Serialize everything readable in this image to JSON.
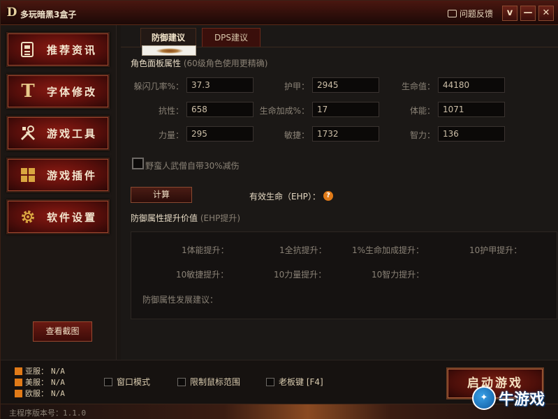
{
  "app": {
    "title": "多玩暗黑3盒子",
    "logo_letter": "D"
  },
  "titlebar": {
    "feedback_label": "问题反馈",
    "buttons": [
      "v",
      "—",
      "✕"
    ]
  },
  "sidebar": {
    "items": [
      {
        "label": "推荐资讯",
        "icon": "news-icon"
      },
      {
        "label": "字体修改",
        "icon": "font-icon"
      },
      {
        "label": "游戏工具",
        "icon": "tools-icon"
      },
      {
        "label": "游戏插件",
        "icon": "plugins-icon"
      },
      {
        "label": "软件设置",
        "icon": "gear-icon"
      }
    ],
    "screenshot_button": "查看截图"
  },
  "tabs": {
    "active": "防御建议",
    "other": "DPS建议"
  },
  "panel": {
    "title": "角色面板属性",
    "subtitle": "(60级角色使用更精确)",
    "fields": [
      {
        "label": "躲闪几率%：",
        "value": "37.3"
      },
      {
        "label": "护甲：",
        "value": "2945"
      },
      {
        "label": "生命值：",
        "value": "44180"
      },
      {
        "label": "抗性：",
        "value": "658"
      },
      {
        "label": "生命加成%：",
        "value": "17"
      },
      {
        "label": "体能：",
        "value": "1071"
      },
      {
        "label": "力量：",
        "value": "295"
      },
      {
        "label": "敏捷：",
        "value": "1732"
      },
      {
        "label": "智力：",
        "value": "136"
      }
    ],
    "barbarian_checkbox": "野蛮人武僧自带30%减伤",
    "calc_button": "计算",
    "ehp_label": "有效生命（EHP）：",
    "help_glyph": "?"
  },
  "results": {
    "title": "防御属性提升价值",
    "subtitle": "(EHP提升)",
    "items": [
      "1体能提升：",
      "1全抗提升：",
      "1%生命加成提升：",
      "10护甲提升：",
      "10敏捷提升：",
      "10力量提升：",
      "10智力提升："
    ],
    "advice": "防御属性发展建议："
  },
  "servers": [
    {
      "name": "亚服：",
      "status": "N/A"
    },
    {
      "name": "美服：",
      "status": "N/A"
    },
    {
      "name": "欧服：",
      "status": "N/A"
    }
  ],
  "options": [
    "窗口模式",
    "限制鼠标范围",
    "老板键 [F4]"
  ],
  "start_button": "启动游戏",
  "status": {
    "version": "主程序版本号：1.1.0"
  },
  "watermark": {
    "text": "牛游戏"
  },
  "colors": {
    "accent": "#e07a18",
    "brand_red": "#5a0f0b"
  }
}
